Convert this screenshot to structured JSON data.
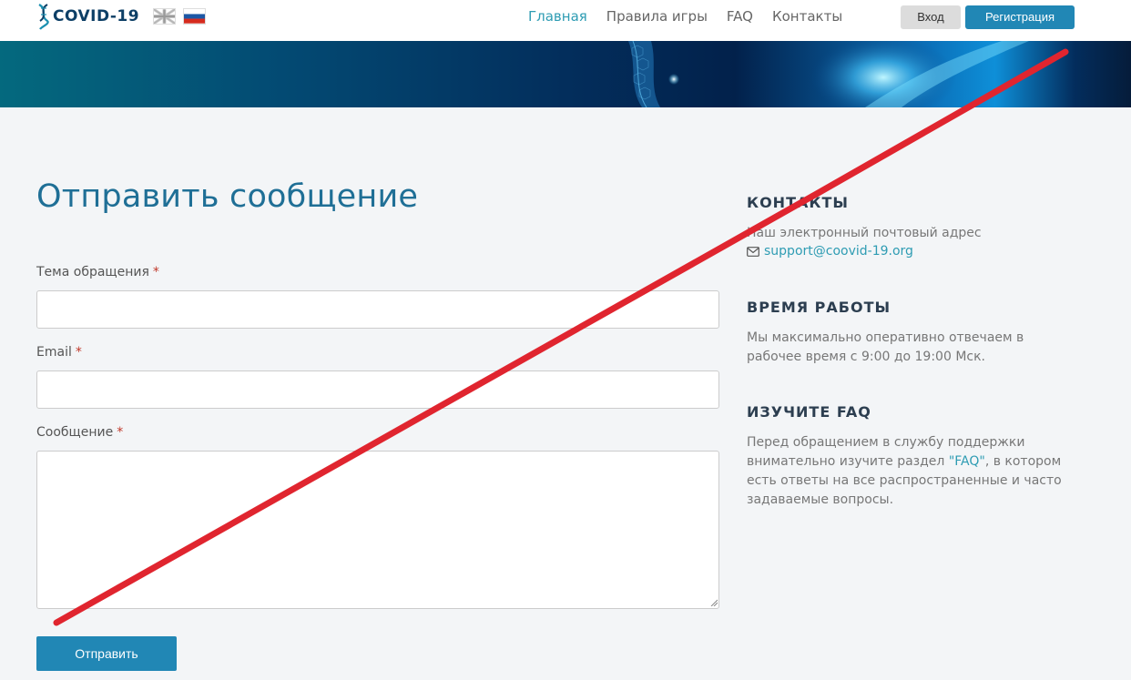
{
  "header": {
    "logo_text": "COVID-19",
    "languages": [
      "en",
      "ru"
    ],
    "nav": [
      {
        "label": "Главная",
        "active": true
      },
      {
        "label": "Правила игры",
        "active": false
      },
      {
        "label": "FAQ",
        "active": false
      },
      {
        "label": "Контакты",
        "active": false
      }
    ],
    "login_label": "Вход",
    "register_label": "Регистрация"
  },
  "form": {
    "title": "Отправить сообщение",
    "required_mark": "*",
    "subject_label": "Тема обращения",
    "subject_value": "",
    "email_label": "Email",
    "email_value": "",
    "message_label": "Сообщение",
    "message_value": "",
    "submit_label": "Отправить"
  },
  "sidebar": {
    "contacts_heading": "КОНТАКТЫ",
    "contacts_text": "Наш электронный почтовый адрес",
    "email": "support@coovid-19.org",
    "hours_heading": "ВРЕМЯ РАБОТЫ",
    "hours_text": "Мы максимально оперативно отвечаем в рабочее время с 9:00 до 19:00 Мск.",
    "faq_heading": "ИЗУЧИТЕ FAQ",
    "faq_text_before": "Перед обращением в службу поддержки внимательно изучите раздел ",
    "faq_link": "\"FAQ\"",
    "faq_text_after": ", в котором есть ответы на все распространенные и часто задаваемые вопросы."
  },
  "colors": {
    "accent": "#2187b5",
    "link": "#2e9cb3",
    "title": "#1f6f96",
    "strike": "#e0252f",
    "background": "#f3f5f7"
  },
  "icons": [
    "dna-icon",
    "uk-flag-icon",
    "ru-flag-icon",
    "envelope-icon"
  ]
}
